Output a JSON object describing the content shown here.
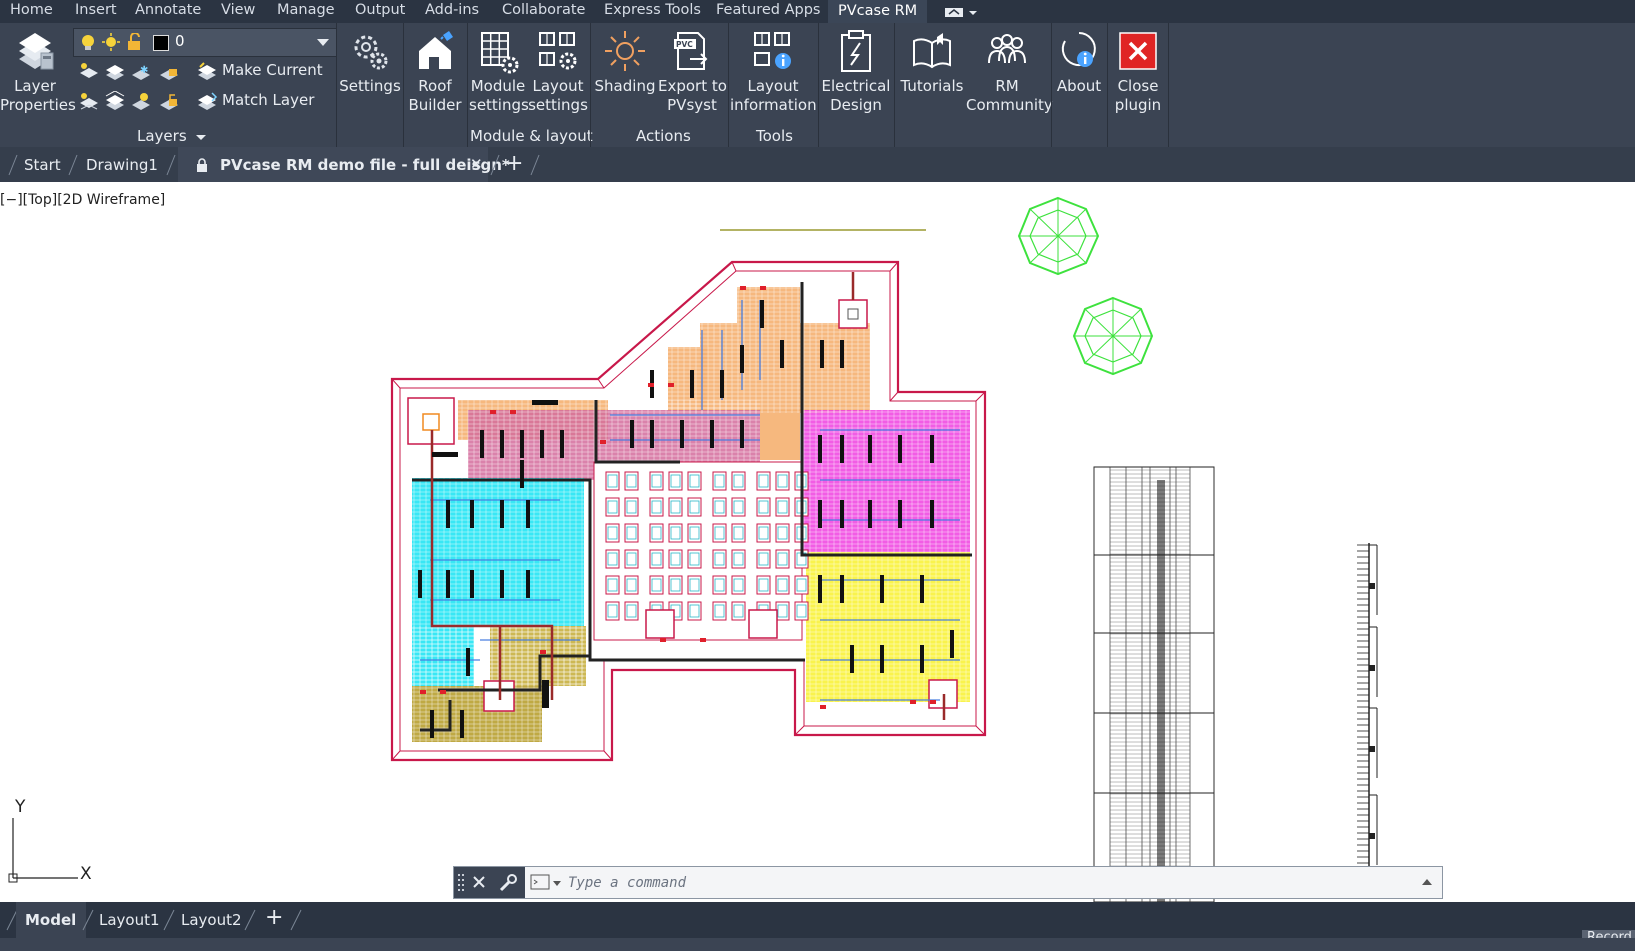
{
  "menu": {
    "items": [
      "Home",
      "Insert",
      "Annotate",
      "View",
      "Manage",
      "Output",
      "Add-ins",
      "Collaborate",
      "Express Tools",
      "Featured Apps",
      "PVcase RM"
    ],
    "active": "PVcase RM"
  },
  "ribbon": {
    "layer_properties": [
      "Layer",
      "Properties"
    ],
    "layer_current": "0",
    "make_current": "Make Current",
    "match_layer": "Match Layer",
    "layers_group": "Layers",
    "settings": "Settings",
    "roof_builder": [
      "Roof",
      "Builder"
    ],
    "module_settings": [
      "Module",
      "settings"
    ],
    "layout_settings": [
      "Layout",
      "settings"
    ],
    "module_layout_group": "Module & layout",
    "shading": "Shading",
    "export_pvsyst": [
      "Export to",
      "PVsyst"
    ],
    "actions_group": "Actions",
    "layout_information": [
      "Layout",
      "information"
    ],
    "tools_group": "Tools",
    "electrical_design": [
      "Electrical",
      "Design"
    ],
    "tutorials": "Tutorials",
    "rm_community": [
      "RM",
      "Community"
    ],
    "about": "About",
    "close_plugin": [
      "Close",
      "plugin"
    ],
    "pvc_badge": "PVC"
  },
  "doc_tabs": {
    "start": "Start",
    "drawing1": "Drawing1",
    "active": "PVcase RM demo file - full deisgn*",
    "close": "✕",
    "add": "+"
  },
  "viewport": {
    "label": "[−][Top][2D Wireframe]",
    "ucs_y": "Y",
    "ucs_x": "X"
  },
  "command": {
    "placeholder": "Type a command"
  },
  "layout_tabs": {
    "model": "Model",
    "layout1": "Layout1",
    "layout2": "Layout2",
    "add": "+"
  },
  "status": {
    "record": "Record"
  },
  "colors": {
    "ribbon_bg": "#3b4453",
    "menu_bg": "#2b3442",
    "roof_outline": "#c8184a",
    "cyan_zone": "#19e0f0",
    "magenta_zone": "#f030d8",
    "orange_zone": "#f0a050",
    "yellow_zone": "#f8f23a",
    "olive_zone": "#b5a030",
    "tree_green": "#3ee23e",
    "close_red": "#e02424"
  }
}
